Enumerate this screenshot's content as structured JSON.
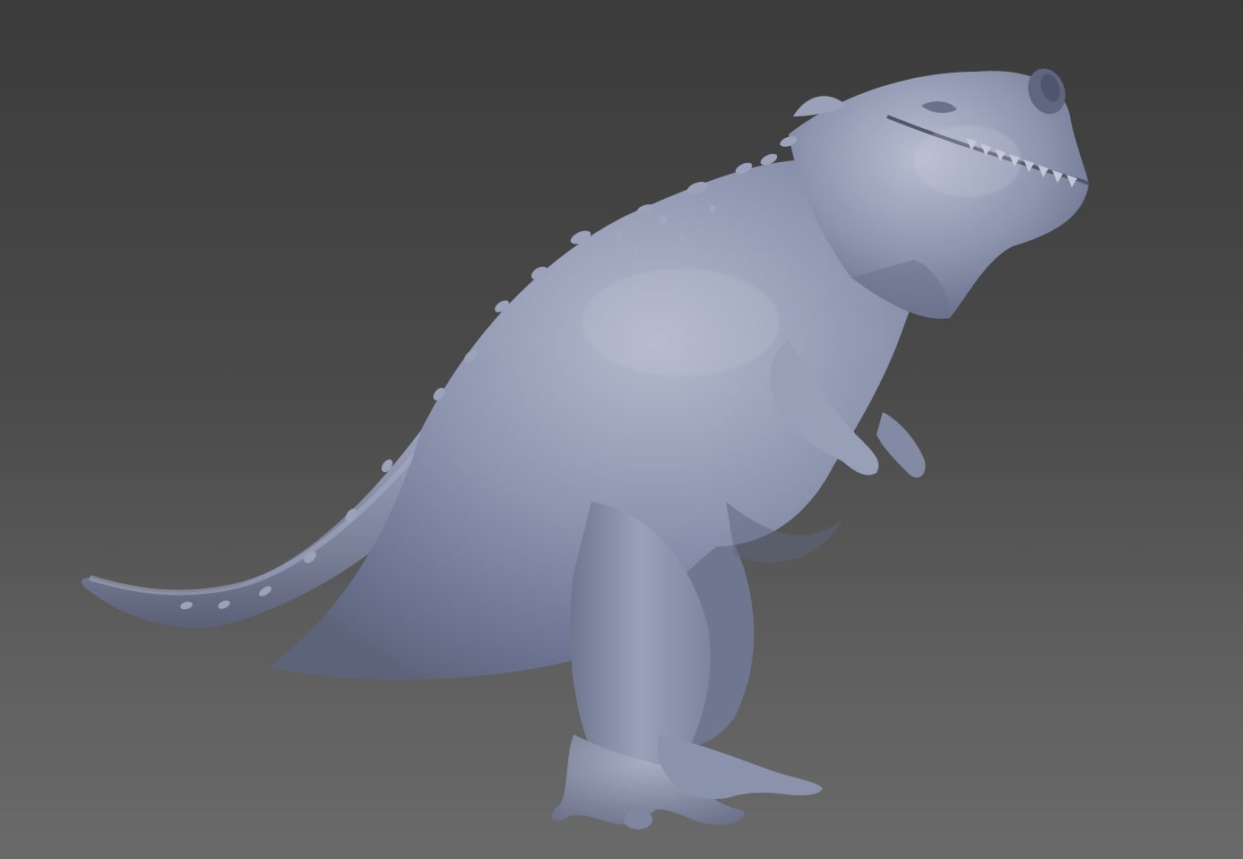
{
  "viewport": {
    "background_top": "#3b3b3b",
    "background_bottom": "#6a6a6a"
  },
  "model": {
    "subject": "dinosaur-sculpt",
    "material_color": "#8a92ad",
    "shadow_color": "#5d6479",
    "highlight_color": "#b4bacc"
  }
}
